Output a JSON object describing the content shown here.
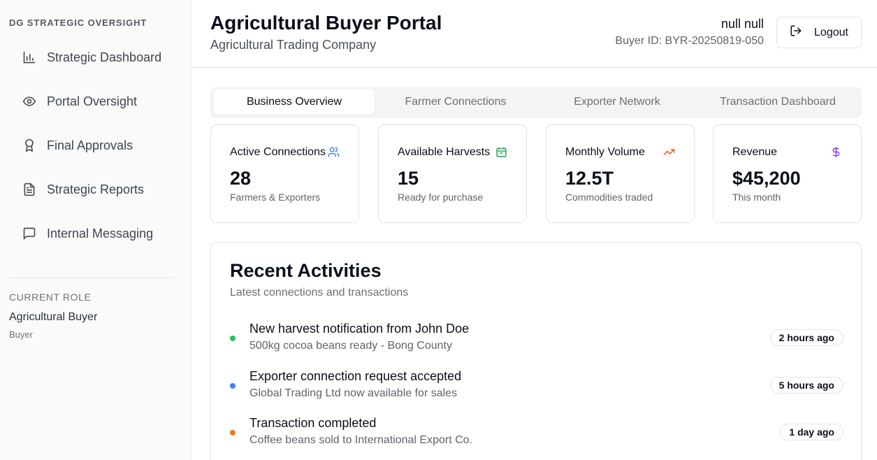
{
  "sidebar": {
    "brand": "DG STRATEGIC OVERSIGHT",
    "items": [
      {
        "label": "Strategic Dashboard",
        "icon": "bar-chart-icon"
      },
      {
        "label": "Portal Oversight",
        "icon": "eye-icon"
      },
      {
        "label": "Final Approvals",
        "icon": "award-icon"
      },
      {
        "label": "Strategic Reports",
        "icon": "file-text-icon"
      },
      {
        "label": "Internal Messaging",
        "icon": "message-square-icon"
      }
    ],
    "role_heading": "CURRENT ROLE",
    "role_name": "Agricultural Buyer",
    "role_sub": "Buyer"
  },
  "header": {
    "title": "Agricultural Buyer Portal",
    "subtitle": "Agricultural Trading Company",
    "user_name": "null null",
    "buyer_id": "Buyer ID: BYR-20250819-050",
    "logout_label": "Logout"
  },
  "tabs": [
    {
      "label": "Business Overview",
      "active": true
    },
    {
      "label": "Farmer Connections",
      "active": false
    },
    {
      "label": "Exporter Network",
      "active": false
    },
    {
      "label": "Transaction Dashboard",
      "active": false
    }
  ],
  "stats": [
    {
      "label": "Active Connections",
      "value": "28",
      "sub": "Farmers & Exporters",
      "icon": "users-icon",
      "color": "#3b82f6"
    },
    {
      "label": "Available Harvests",
      "value": "15",
      "sub": "Ready for purchase",
      "icon": "package-icon",
      "color": "#16a34a"
    },
    {
      "label": "Monthly Volume",
      "value": "12.5T",
      "sub": "Commodities traded",
      "icon": "trending-up-icon",
      "color": "#ea580c"
    },
    {
      "label": "Revenue",
      "value": "$45,200",
      "sub": "This month",
      "icon": "dollar-sign-icon",
      "color": "#9333ea"
    }
  ],
  "activities": {
    "title": "Recent Activities",
    "subtitle": "Latest connections and transactions",
    "items": [
      {
        "title": "New harvest notification from John Doe",
        "detail": "500kg cocoa beans ready - Bong County",
        "time": "2 hours ago",
        "color": "#22c55e"
      },
      {
        "title": "Exporter connection request accepted",
        "detail": "Global Trading Ltd now available for sales",
        "time": "5 hours ago",
        "color": "#3b82f6"
      },
      {
        "title": "Transaction completed",
        "detail": "Coffee beans sold to International Export Co.",
        "time": "1 day ago",
        "color": "#f97316"
      }
    ]
  }
}
